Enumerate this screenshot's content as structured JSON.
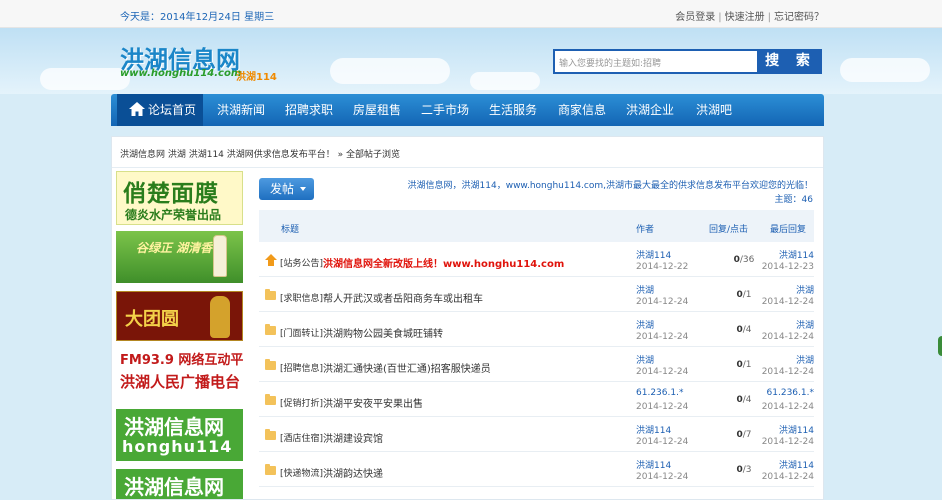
{
  "topbar": {
    "date": "今天是：2014年12月24日 星期三",
    "login": "会员登录",
    "register": "快速注册",
    "forgot": "忘记密码？"
  },
  "header": {
    "logo_cn": "洪湖信息网",
    "logo_en": "www.honghu114.com",
    "logo_tag": "洪湖114",
    "search_placeholder": "输入您要找的主题如:招聘",
    "search_button": "搜 索"
  },
  "nav": {
    "items": [
      "论坛首页",
      "洪湖新闻",
      "招聘求职",
      "房屋租售",
      "二手市场",
      "生活服务",
      "商家信息",
      "洪湖企业",
      "洪湖吧"
    ]
  },
  "breadcrumb": {
    "path": "洪湖信息网 洪湖 洪湖114 洪湖网供求信息发布平台！",
    "current": "» 全部帖子浏览"
  },
  "ads": {
    "ad1_line1": "俏楚面膜",
    "ad1_line2": "德炎水产荣誉出品",
    "ad2_text": "谷绿正 湖清香",
    "ad3_text": "大团圆",
    "ad4_line1": "FM93.9 网络互动平台",
    "ad4_line2": "洪湖人民广播电台",
    "ad5_line1": "洪湖信息网",
    "ad5_line2": "honghu114",
    "ad6_line1": "洪湖信息网"
  },
  "forum": {
    "post_button": "发帖",
    "notice": "洪湖信息网，洪湖114，www.honghu114.com,洪湖市最大最全的供求信息发布平台欢迎您的光临！",
    "topics": "主题：46",
    "columns": {
      "title": "标题",
      "author": "作者",
      "stats": "回复/点击",
      "last": "最后回复"
    },
    "threads": [
      {
        "category": "[站务公告]",
        "title": "洪湖信息网全新改版上线！www.honghu114.com",
        "author": "洪湖114",
        "date": "2014-12-22",
        "replies": "0",
        "views": "/36",
        "last_user": "洪湖114",
        "last_date": "2014-12-23",
        "sticky": true
      },
      {
        "category": "[求职信息]",
        "title": "帮人开武汉或者岳阳商务车或出租车",
        "author": "洪湖",
        "date": "2014-12-24",
        "replies": "0",
        "views": "/1",
        "last_user": "洪湖",
        "last_date": "2014-12-24"
      },
      {
        "category": "[门面转让]",
        "title": "洪湖购物公园美食城旺铺转",
        "author": "洪湖",
        "date": "2014-12-24",
        "replies": "0",
        "views": "/4",
        "last_user": "洪湖",
        "last_date": "2014-12-24"
      },
      {
        "category": "[招聘信息]",
        "title": "洪湖汇通快递(百世汇通)招客服快递员",
        "author": "洪湖",
        "date": "2014-12-24",
        "replies": "0",
        "views": "/1",
        "last_user": "洪湖",
        "last_date": "2014-12-24"
      },
      {
        "category": "[促销打折]",
        "title": "洪湖平安夜平安果出售",
        "author": "61.236.1.*",
        "date": "2014-12-24",
        "replies": "0",
        "views": "/4",
        "last_user": "61.236.1.*",
        "last_date": "2014-12-24"
      },
      {
        "category": "[酒店住宿]",
        "title": "洪湖建设宾馆",
        "author": "洪湖114",
        "date": "2014-12-24",
        "replies": "0",
        "views": "/7",
        "last_user": "洪湖114",
        "last_date": "2014-12-24"
      },
      {
        "category": "[快递物流]",
        "title": "洪湖韵达快递",
        "author": "洪湖114",
        "date": "2014-12-24",
        "replies": "0",
        "views": "/3",
        "last_user": "洪湖114",
        "last_date": "2014-12-24"
      }
    ]
  },
  "colors": {
    "brand_blue": "#1d5fb2",
    "nav_blue": "#1365b4",
    "hot_red": "#e0140c"
  }
}
